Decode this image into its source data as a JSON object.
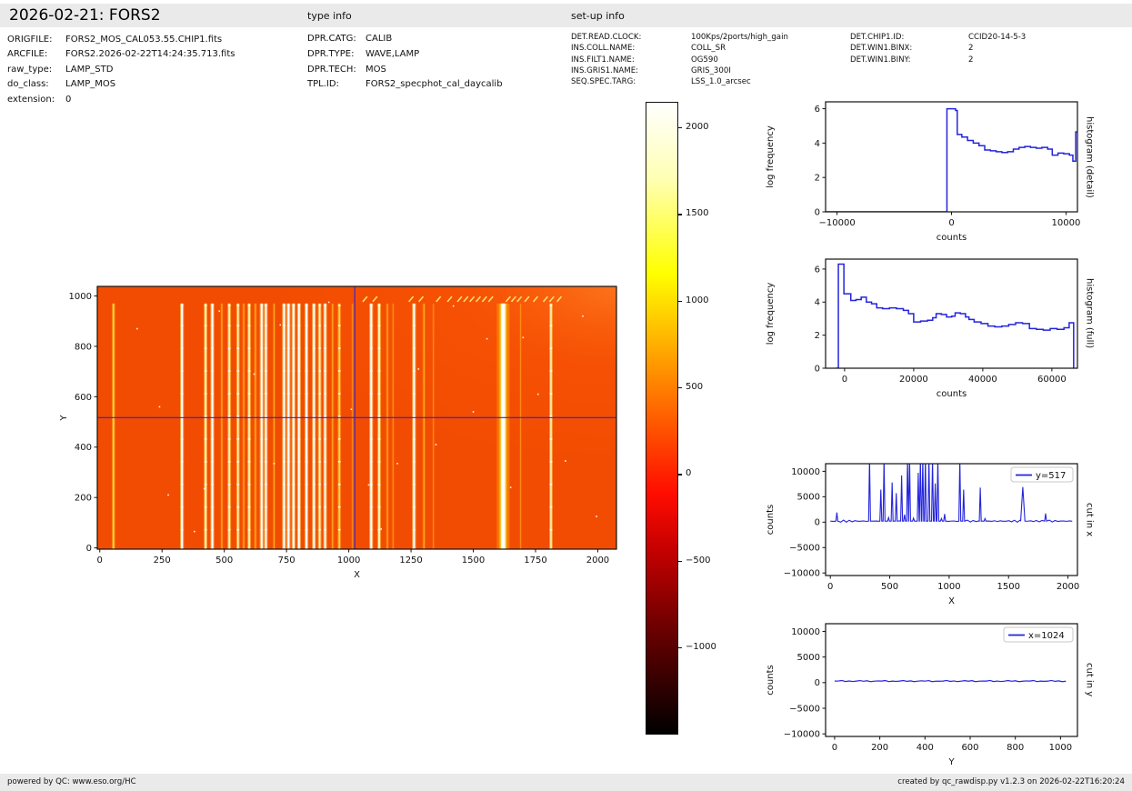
{
  "header": {
    "title": "2026-02-21: FORS2"
  },
  "file_info": {
    "rows": [
      {
        "label": "ORIGFILE:",
        "value": "FORS2_MOS_CAL053.55.CHIP1.fits"
      },
      {
        "label": "ARCFILE:",
        "value": "FORS2.2026-02-22T14:24:35.713.fits"
      },
      {
        "label": "raw_type:",
        "value": "LAMP_STD"
      },
      {
        "label": "do_class:",
        "value": "LAMP_MOS"
      },
      {
        "label": "extension:",
        "value": "0"
      }
    ]
  },
  "type_info": {
    "heading": "type info",
    "rows": [
      {
        "label": "DPR.CATG:",
        "value": "CALIB"
      },
      {
        "label": "DPR.TYPE:",
        "value": "WAVE,LAMP"
      },
      {
        "label": "DPR.TECH:",
        "value": "MOS"
      },
      {
        "label": "TPL.ID:",
        "value": "FORS2_specphot_cal_daycalib"
      }
    ]
  },
  "setup_info": {
    "heading": "set-up info",
    "col1": [
      {
        "label": "DET.READ.CLOCK:",
        "value": "100Kps/2ports/high_gain"
      },
      {
        "label": "INS.COLL.NAME:",
        "value": "COLL_SR"
      },
      {
        "label": "INS.FILT1.NAME:",
        "value": "OG590"
      },
      {
        "label": "INS.GRIS1.NAME:",
        "value": "GRIS_300I"
      },
      {
        "label": "SEQ.SPEC.TARG:",
        "value": "LSS_1.0_arcsec"
      }
    ],
    "col2": [
      {
        "label": "DET.CHIP1.ID:",
        "value": "CCID20-14-5-3"
      },
      {
        "label": "DET.WIN1.BINX:",
        "value": "2"
      },
      {
        "label": "DET.WIN1.BINY:",
        "value": "2"
      }
    ]
  },
  "footer": {
    "left": "powered by QC: www.eso.org/HC",
    "right": "created by qc_rawdisp.py v1.2.3 on 2026-02-22T16:20:24"
  },
  "colors": {
    "accent_blue": "#2424dc",
    "axis_black": "#111111",
    "panel_gray": "#eaeaea",
    "image_background": "#f24c02"
  },
  "chart_data": [
    {
      "id": "raw-image",
      "type": "heatmap",
      "xlabel": "X",
      "ylabel": "Y",
      "xlim": [
        -10,
        2075
      ],
      "ylim": [
        -5,
        1038
      ],
      "xticks": [
        0,
        250,
        500,
        750,
        1000,
        1250,
        1500,
        1750,
        2000
      ],
      "yticks": [
        0,
        200,
        400,
        600,
        800,
        1000
      ],
      "colormap": "hot",
      "background_counts": 250,
      "bg_color": "#f24c02",
      "crosshair": {
        "x": 1024,
        "y": 517
      },
      "line_y_extent": [
        0,
        970
      ],
      "spectral_lines": [
        {
          "x": 55,
          "i": 0.6,
          "w": 1.5
        },
        {
          "x": 330,
          "i": 1,
          "w": 2
        },
        {
          "x": 425,
          "i": 0.85,
          "w": 1.8
        },
        {
          "x": 452,
          "i": 1,
          "w": 2
        },
        {
          "x": 490,
          "i": 0.5,
          "w": 1.2
        },
        {
          "x": 520,
          "i": 0.9,
          "w": 1.8
        },
        {
          "x": 555,
          "i": 0.8,
          "w": 1.6
        },
        {
          "x": 578,
          "i": 0.4,
          "w": 1.2
        },
        {
          "x": 600,
          "i": 0.9,
          "w": 1.8
        },
        {
          "x": 625,
          "i": 0.55,
          "w": 1.4
        },
        {
          "x": 650,
          "i": 1,
          "w": 2
        },
        {
          "x": 667,
          "i": 1,
          "w": 1.8
        },
        {
          "x": 700,
          "i": 0.45,
          "w": 1.2
        },
        {
          "x": 740,
          "i": 0.95,
          "w": 2
        },
        {
          "x": 758,
          "i": 1,
          "w": 2
        },
        {
          "x": 778,
          "i": 1,
          "w": 2
        },
        {
          "x": 800,
          "i": 1,
          "w": 2
        },
        {
          "x": 830,
          "i": 0.95,
          "w": 2
        },
        {
          "x": 860,
          "i": 1,
          "w": 2
        },
        {
          "x": 883,
          "i": 0.85,
          "w": 1.8
        },
        {
          "x": 905,
          "i": 0.95,
          "w": 1.8
        },
        {
          "x": 935,
          "i": 0.45,
          "w": 1.2
        },
        {
          "x": 962,
          "i": 0.75,
          "w": 1.6
        },
        {
          "x": 1015,
          "i": 0.25,
          "w": 1
        },
        {
          "x": 1090,
          "i": 0.95,
          "w": 2
        },
        {
          "x": 1122,
          "i": 0.9,
          "w": 2
        },
        {
          "x": 1155,
          "i": 0.4,
          "w": 1.2
        },
        {
          "x": 1178,
          "i": 0.35,
          "w": 1.2
        },
        {
          "x": 1262,
          "i": 0.95,
          "w": 2
        },
        {
          "x": 1302,
          "i": 0.55,
          "w": 1.4
        },
        {
          "x": 1340,
          "i": 0.3,
          "w": 1
        },
        {
          "x": 1620,
          "i": 1,
          "w": 3.5,
          "glow": true
        },
        {
          "x": 1690,
          "i": 0.3,
          "w": 1
        },
        {
          "x": 1812,
          "i": 0.8,
          "w": 1.6
        }
      ],
      "slit_breaks": [
        75,
        165,
        255,
        345,
        435,
        525,
        615,
        705,
        795,
        885,
        965
      ],
      "top_dashes": [
        1065,
        1105,
        1250,
        1290,
        1360,
        1405,
        1445,
        1470,
        1495,
        1520,
        1545,
        1570,
        1640,
        1662,
        1685,
        1715,
        1750,
        1790,
        1815,
        1845
      ],
      "hot_pixels": [
        [
          150,
          870
        ],
        [
          275,
          210
        ],
        [
          420,
          235
        ],
        [
          520,
          790
        ],
        [
          620,
          690
        ],
        [
          700,
          335
        ],
        [
          760,
          450
        ],
        [
          830,
          125
        ],
        [
          920,
          975
        ],
        [
          1010,
          550
        ],
        [
          1080,
          250
        ],
        [
          1195,
          335
        ],
        [
          1280,
          710
        ],
        [
          1350,
          410
        ],
        [
          1420,
          960
        ],
        [
          1500,
          540
        ],
        [
          1555,
          830
        ],
        [
          1650,
          240
        ],
        [
          1700,
          835
        ],
        [
          1760,
          610
        ],
        [
          1870,
          345
        ],
        [
          1940,
          920
        ],
        [
          1995,
          125
        ],
        [
          380,
          65
        ],
        [
          240,
          560
        ],
        [
          480,
          940
        ],
        [
          1130,
          75
        ],
        [
          725,
          885
        ]
      ]
    },
    {
      "id": "colorbar",
      "type": "colorbar",
      "ticks": [
        2000,
        1500,
        1000,
        500,
        0,
        -500,
        -1000
      ],
      "vmin": -1500,
      "vmax": 2150,
      "gradient": [
        {
          "c": "#000000",
          "p": 0
        },
        {
          "c": "#6e0000",
          "p": 17
        },
        {
          "c": "#c40000",
          "p": 29
        },
        {
          "c": "#ff0c00",
          "p": 38
        },
        {
          "c": "#ff8000",
          "p": 55
        },
        {
          "c": "#ffff00",
          "p": 73
        },
        {
          "c": "#ffffb4",
          "p": 88
        },
        {
          "c": "#ffffff",
          "p": 100
        }
      ]
    },
    {
      "id": "hist-detail",
      "type": "step",
      "xlabel": "counts",
      "ylabel": "log frequency",
      "right_label": "histogram (detail)",
      "xlim": [
        -11000,
        11000
      ],
      "ylim": [
        0,
        6.4
      ],
      "xticks": [
        -10000,
        0,
        10000
      ],
      "yticks": [
        0,
        2,
        4,
        6
      ],
      "steps": [
        [
          -11000,
          0
        ],
        [
          -400,
          6.0
        ],
        [
          350,
          5.9
        ],
        [
          500,
          4.5
        ],
        [
          900,
          4.35
        ],
        [
          1400,
          4.15
        ],
        [
          1900,
          4.0
        ],
        [
          2400,
          3.85
        ],
        [
          2900,
          3.6
        ],
        [
          3400,
          3.55
        ],
        [
          3900,
          3.5
        ],
        [
          4400,
          3.45
        ],
        [
          4900,
          3.5
        ],
        [
          5400,
          3.65
        ],
        [
          5900,
          3.75
        ],
        [
          6400,
          3.8
        ],
        [
          6900,
          3.75
        ],
        [
          7400,
          3.7
        ],
        [
          7900,
          3.75
        ],
        [
          8400,
          3.65
        ],
        [
          8800,
          3.3
        ],
        [
          9300,
          3.42
        ],
        [
          9800,
          3.38
        ],
        [
          10300,
          3.3
        ],
        [
          10600,
          2.95
        ],
        [
          10850,
          4.65
        ],
        [
          11000,
          4.65
        ]
      ]
    },
    {
      "id": "hist-full",
      "type": "step",
      "xlabel": "counts",
      "ylabel": "log frequency",
      "right_label": "histogram (full)",
      "xlim": [
        -5500,
        67400
      ],
      "ylim": [
        0,
        6.6
      ],
      "xticks": [
        0,
        20000,
        40000,
        60000
      ],
      "yticks": [
        0,
        2,
        4,
        6
      ],
      "steps": [
        [
          -2500,
          0
        ],
        [
          -1800,
          6.3
        ],
        [
          -200,
          4.5
        ],
        [
          1800,
          4.1
        ],
        [
          3300,
          4.15
        ],
        [
          4800,
          4.3
        ],
        [
          6300,
          4.0
        ],
        [
          7800,
          3.9
        ],
        [
          9300,
          3.65
        ],
        [
          11000,
          3.6
        ],
        [
          13000,
          3.65
        ],
        [
          15000,
          3.6
        ],
        [
          17000,
          3.5
        ],
        [
          18500,
          3.3
        ],
        [
          20000,
          2.8
        ],
        [
          22000,
          2.85
        ],
        [
          24000,
          2.9
        ],
        [
          25500,
          3.05
        ],
        [
          26500,
          3.3
        ],
        [
          28000,
          3.25
        ],
        [
          29500,
          3.1
        ],
        [
          31000,
          3.15
        ],
        [
          32000,
          3.35
        ],
        [
          33500,
          3.3
        ],
        [
          35000,
          3.1
        ],
        [
          36000,
          2.95
        ],
        [
          37500,
          2.8
        ],
        [
          39500,
          2.7
        ],
        [
          41500,
          2.55
        ],
        [
          43500,
          2.5
        ],
        [
          45500,
          2.55
        ],
        [
          47500,
          2.65
        ],
        [
          49500,
          2.75
        ],
        [
          51500,
          2.7
        ],
        [
          53500,
          2.4
        ],
        [
          55500,
          2.35
        ],
        [
          57500,
          2.3
        ],
        [
          59500,
          2.4
        ],
        [
          61500,
          2.35
        ],
        [
          63500,
          2.45
        ],
        [
          65000,
          2.75
        ],
        [
          66300,
          0
        ]
      ]
    },
    {
      "id": "cut-x",
      "type": "line",
      "xlabel": "X",
      "ylabel": "counts",
      "right_label": "cut in x",
      "legend": "y=517",
      "xlim": [
        -40,
        2080
      ],
      "ylim": [
        -10500,
        11500
      ],
      "xticks": [
        0,
        500,
        1000,
        1500,
        2000
      ],
      "yticks": [
        10000,
        5000,
        0,
        -5000,
        -10000
      ],
      "baseline": 200,
      "peaks": [
        [
          55,
          1900
        ],
        [
          330,
          12500
        ],
        [
          425,
          6400
        ],
        [
          452,
          12500
        ],
        [
          490,
          900
        ],
        [
          520,
          7800
        ],
        [
          555,
          5700
        ],
        [
          600,
          9200
        ],
        [
          625,
          1500
        ],
        [
          650,
          12500
        ],
        [
          667,
          12500
        ],
        [
          700,
          800
        ],
        [
          740,
          9700
        ],
        [
          758,
          12500
        ],
        [
          778,
          12500
        ],
        [
          800,
          12500
        ],
        [
          830,
          12500
        ],
        [
          860,
          12500
        ],
        [
          883,
          7600
        ],
        [
          905,
          12500
        ],
        [
          935,
          700
        ],
        [
          962,
          1600
        ],
        [
          1090,
          12500
        ],
        [
          1122,
          6400
        ],
        [
          1262,
          6800
        ],
        [
          1302,
          700
        ],
        [
          1620,
          6900,
          18
        ],
        [
          1812,
          1700
        ]
      ]
    },
    {
      "id": "cut-y",
      "type": "line",
      "xlabel": "Y",
      "ylabel": "counts",
      "right_label": "cut in y",
      "legend": "x=1024",
      "xlim": [
        -40,
        1075
      ],
      "ylim": [
        -10500,
        11500
      ],
      "xticks": [
        0,
        200,
        400,
        600,
        800,
        1000
      ],
      "yticks": [
        10000,
        5000,
        0,
        -5000,
        -10000
      ],
      "flat_value": 300,
      "x_extent": [
        0,
        1030
      ]
    }
  ]
}
